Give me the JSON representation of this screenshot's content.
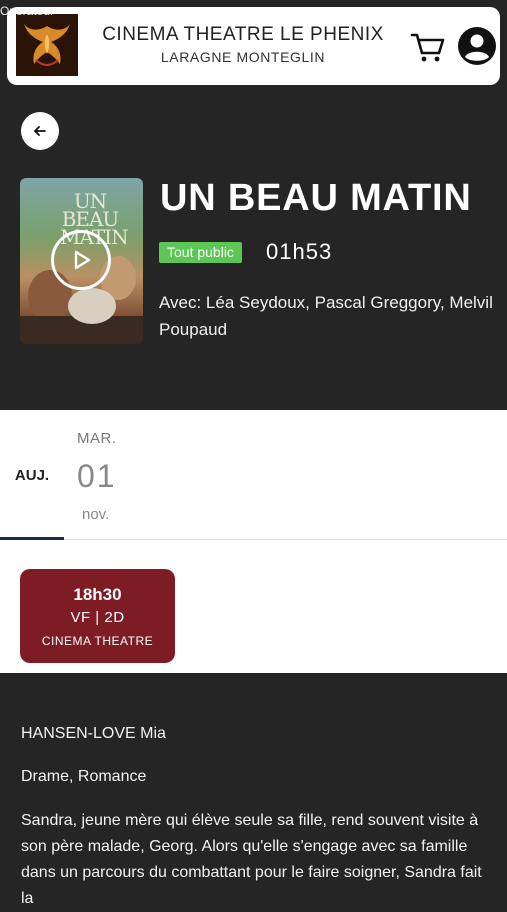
{
  "status": {
    "text": "Operateur"
  },
  "header": {
    "title": "CINEMA THEATRE LE PHENIX",
    "subtitle": "LARAGNE MONTEGLIN",
    "cart_icon": "cart-icon",
    "account_icon": "account-icon"
  },
  "movie": {
    "title": "UN BEAU MATIN",
    "rating": "Tout public",
    "duration": "01h53",
    "cast": "Avec: Léa Seydoux, Pascal Greggory, Melvil Poupaud",
    "poster_title": "UN BEAU MATIN"
  },
  "dates": {
    "today_label": "AUJ.",
    "day_name": "MAR.",
    "day_number": "01",
    "month": "nov."
  },
  "showtime": {
    "time": "18h30",
    "version": "VF | 2D",
    "room": "CINEMA THEATRE"
  },
  "details": {
    "director": "HANSEN-LOVE Mia",
    "genre": "Drame, Romance",
    "synopsis": "Sandra, jeune mère qui élève seule sa fille, rend souvent visite à son père malade, Georg. Alors qu'elle s'engage avec sa famille dans un parcours du combattant pour le faire soigner, Sandra fait la"
  },
  "colors": {
    "background_dark": "#252525",
    "rating_green": "#5dc756",
    "showtime_red": "#7d1c25",
    "tab_underline": "#1c2b44"
  }
}
